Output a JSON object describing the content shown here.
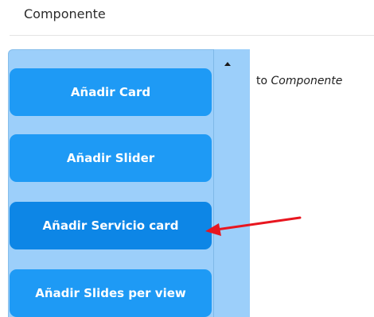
{
  "section": {
    "title": "Componente"
  },
  "menu": {
    "items": [
      {
        "label": "Añadir Card"
      },
      {
        "label": "Añadir Slider"
      },
      {
        "label": "Añadir Servicio card"
      },
      {
        "label": "Añadir Slides per view"
      }
    ]
  },
  "hint": {
    "prefix": "to",
    "target": "Componente"
  },
  "colors": {
    "panel": "#9ccffa",
    "button": "#1e9af5",
    "button_active": "#0d86e6",
    "arrow": "#e8161f"
  }
}
